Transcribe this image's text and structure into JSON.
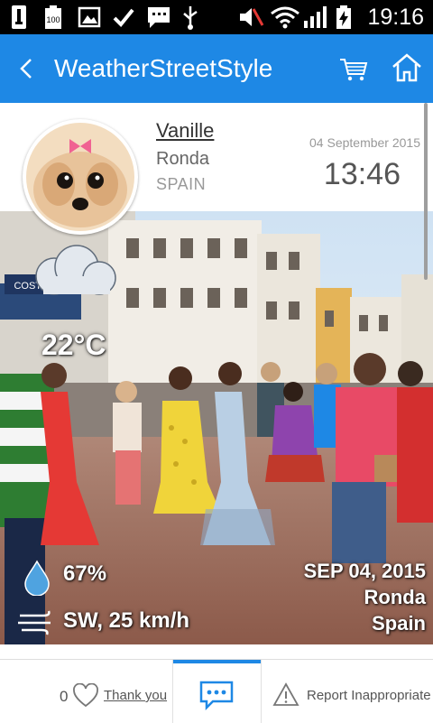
{
  "status_bar": {
    "time": "19:16",
    "icons": [
      "usb-icon",
      "battery-100-icon",
      "image-icon",
      "check-icon",
      "message-icon",
      "usb-debug-icon",
      "mute-icon",
      "wifi-icon",
      "signal-icon",
      "charging-battery-icon"
    ],
    "battery_badge": "100"
  },
  "app_bar": {
    "title": "WeatherStreetStyle",
    "icons": [
      "back-arrow-icon",
      "cart-icon",
      "home-icon"
    ]
  },
  "post": {
    "user_name": "Vanille",
    "city": "Ronda",
    "country": "SPAIN",
    "date": "04 September 2015",
    "time": "13:46"
  },
  "photo_overlay": {
    "weather_icon": "cloud-icon",
    "temperature": "22°C",
    "humidity_icon": "water-drop-icon",
    "humidity": "67%",
    "wind_icon": "wind-icon",
    "wind": "SW, 25 km/h",
    "date_stamp": "SEP 04, 2015",
    "city": "Ronda",
    "country": "Spain",
    "shop_sign": "COSTASOL"
  },
  "bottom_bar": {
    "like_count": "0",
    "thank_you_label": "Thank you",
    "report_label": "Report Inappropriate",
    "accent_color": "#1e88e5"
  },
  "colors": {
    "app_bar": "#1e88e5",
    "status_bar": "#000000"
  }
}
